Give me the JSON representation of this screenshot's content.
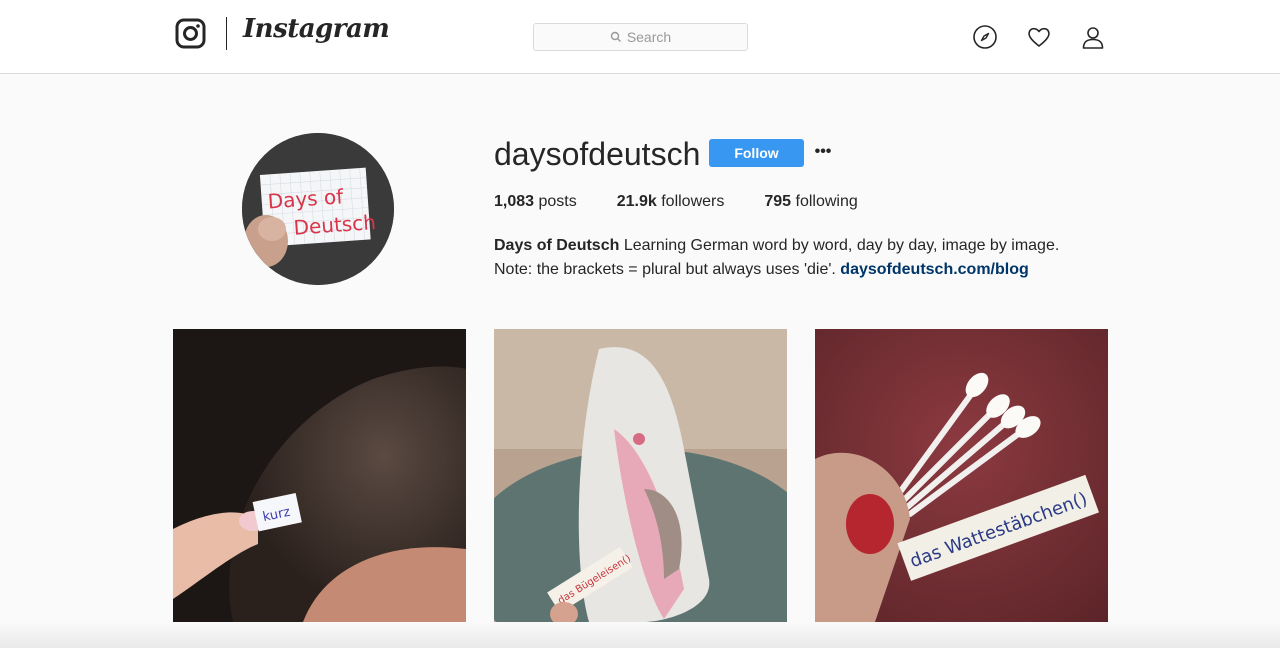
{
  "nav": {
    "wordmark": "Instagram",
    "search_placeholder": "Search",
    "icons": [
      "instagram-glyph-icon",
      "compass-icon",
      "heart-icon",
      "person-icon",
      "search-icon"
    ]
  },
  "profile": {
    "username": "daysofdeutsch",
    "follow_label": "Follow",
    "more_label": "•••",
    "avatar_text_line1": "Days of",
    "avatar_text_line2": "Deutsch",
    "stats": {
      "posts_count": "1,083",
      "posts_label": " posts",
      "followers_count": "21.9k",
      "followers_label": " followers",
      "following_count": "795",
      "following_label": " following"
    },
    "bio": {
      "name": "Days of Deutsch",
      "line1": " Learning German word by word, day by day, image by image.",
      "line2": "Note: the brackets = plural but always uses 'die'. ",
      "link": "daysofdeutsch.com/blog"
    }
  },
  "posts": [
    {
      "caption_card": "kurz"
    },
    {
      "caption_card": "das Bügeleisen()"
    },
    {
      "caption_card": "das Wattestäbchen()"
    }
  ],
  "colors": {
    "accent": "#3897f0",
    "link": "#003569",
    "text": "#262626",
    "border": "#dbdbdb"
  }
}
